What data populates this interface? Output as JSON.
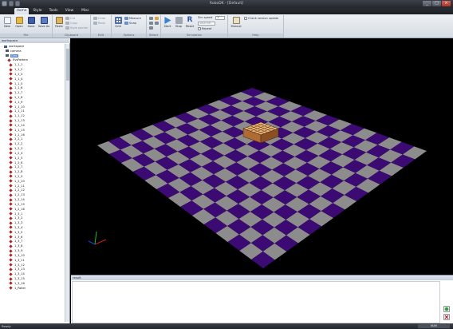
{
  "window": {
    "title": "RoboDK - [Default]",
    "minimize": "_",
    "maximize": "□",
    "close": "×"
  },
  "tabs": [
    "Home",
    "Style",
    "Tools",
    "View",
    "Misc"
  ],
  "active_tab": "Home",
  "ribbon": {
    "groups": [
      {
        "label": "File",
        "buttons": [
          "New",
          "Open",
          "Save",
          "Save As"
        ]
      },
      {
        "label": "Clipboard",
        "buttons": [
          "Paste"
        ],
        "small": [
          "Cut",
          "Copy",
          "Style painter"
        ]
      },
      {
        "label": "Edit",
        "small": [
          "Undo",
          "Redo"
        ]
      },
      {
        "label": "Options",
        "buttons": [
          "Grid"
        ],
        "small": [
          "Measure",
          "Snap"
        ]
      },
      {
        "label": "Select",
        "buttons": []
      },
      {
        "label": "Simulation",
        "buttons": [
          "Start",
          "Stop",
          "Reset"
        ],
        "speed_label": "Sim speed",
        "speed_value": "1",
        "speed_field2": "1000.00",
        "repeat_label": "Repeat"
      },
      {
        "label": "Help",
        "buttons": [
          "Manual"
        ],
        "check_label": "Check version update"
      }
    ]
  },
  "workspace": {
    "title": "workspace",
    "tree": [
      {
        "label": "workspace",
        "level": 0,
        "kind": "root"
      },
      {
        "label": "camera",
        "level": 1,
        "kind": "camera"
      },
      {
        "label": "Grid",
        "level": 1,
        "kind": "grid",
        "selected": true
      },
      {
        "label": "EvsPattern",
        "level": 1,
        "kind": "group"
      },
      {
        "label": "1_1_1",
        "level": 2
      },
      {
        "label": "1_1_2",
        "level": 2
      },
      {
        "label": "1_1_3",
        "level": 2
      },
      {
        "label": "1_1_4",
        "level": 2
      },
      {
        "label": "1_1_5",
        "level": 2
      },
      {
        "label": "1_1_6",
        "level": 2
      },
      {
        "label": "1_1_7",
        "level": 2
      },
      {
        "label": "1_1_8",
        "level": 2
      },
      {
        "label": "1_1_9",
        "level": 2
      },
      {
        "label": "1_1_10",
        "level": 2
      },
      {
        "label": "1_1_11",
        "level": 2
      },
      {
        "label": "1_1_12",
        "level": 2
      },
      {
        "label": "1_1_13",
        "level": 2
      },
      {
        "label": "1_1_14",
        "level": 2
      },
      {
        "label": "1_1_15",
        "level": 2
      },
      {
        "label": "1_1_16",
        "level": 2
      },
      {
        "label": "1_2_1",
        "level": 2
      },
      {
        "label": "1_2_2",
        "level": 2
      },
      {
        "label": "1_2_3",
        "level": 2
      },
      {
        "label": "1_2_4",
        "level": 2
      },
      {
        "label": "1_2_5",
        "level": 2
      },
      {
        "label": "1_2_6",
        "level": 2
      },
      {
        "label": "1_2_7",
        "level": 2
      },
      {
        "label": "1_2_8",
        "level": 2
      },
      {
        "label": "1_2_9",
        "level": 2
      },
      {
        "label": "1_2_10",
        "level": 2
      },
      {
        "label": "1_2_11",
        "level": 2
      },
      {
        "label": "1_2_12",
        "level": 2
      },
      {
        "label": "1_2_13",
        "level": 2
      },
      {
        "label": "1_2_14",
        "level": 2
      },
      {
        "label": "1_2_15",
        "level": 2
      },
      {
        "label": "1_2_16",
        "level": 2
      },
      {
        "label": "1_3_1",
        "level": 2
      },
      {
        "label": "1_3_2",
        "level": 2
      },
      {
        "label": "1_3_3",
        "level": 2
      },
      {
        "label": "1_3_4",
        "level": 2
      },
      {
        "label": "1_3_5",
        "level": 2
      },
      {
        "label": "1_3_6",
        "level": 2
      },
      {
        "label": "1_3_7",
        "level": 2
      },
      {
        "label": "1_3_8",
        "level": 2
      },
      {
        "label": "1_3_9",
        "level": 2
      },
      {
        "label": "1_3_10",
        "level": 2
      },
      {
        "label": "1_3_11",
        "level": 2
      },
      {
        "label": "1_3_12",
        "level": 2
      },
      {
        "label": "1_3_13",
        "level": 2
      },
      {
        "label": "1_3_14",
        "level": 2
      },
      {
        "label": "1_3_15",
        "level": 2
      },
      {
        "label": "1_3_16",
        "level": 2
      },
      {
        "label": "1_Pallet",
        "level": 2
      }
    ]
  },
  "viewport": {
    "floor_color_a": "#3c0a73",
    "floor_color_b": "#8c8c8c",
    "background": "#000000",
    "pallet_color": "#c0824a",
    "axis_colors": {
      "x": "#d42020",
      "y": "#20c020",
      "z": "#2040e0"
    }
  },
  "result": {
    "title": "result",
    "text": ""
  },
  "status": {
    "text": "Ready",
    "right": "NUM"
  }
}
